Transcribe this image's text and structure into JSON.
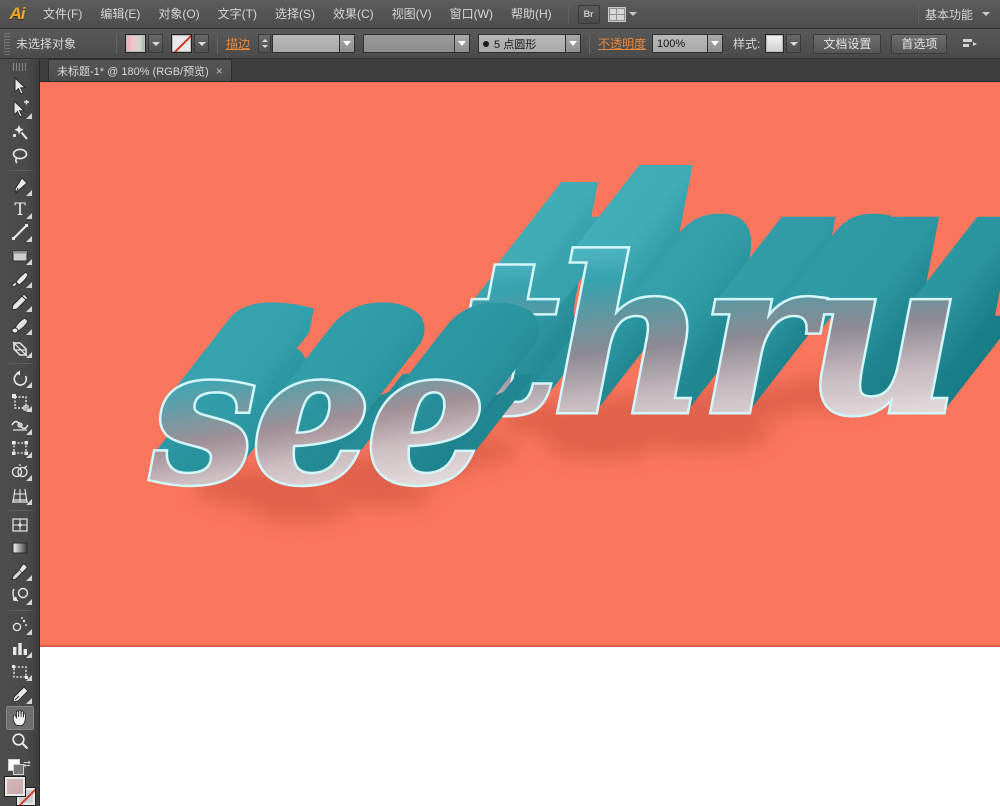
{
  "app": {
    "name": "Adobe Illustrator",
    "logo_text": "Ai"
  },
  "menubar": {
    "items": [
      {
        "label": "文件(F)",
        "name": "menu-file"
      },
      {
        "label": "编辑(E)",
        "name": "menu-edit"
      },
      {
        "label": "对象(O)",
        "name": "menu-object"
      },
      {
        "label": "文字(T)",
        "name": "menu-type"
      },
      {
        "label": "选择(S)",
        "name": "menu-select"
      },
      {
        "label": "效果(C)",
        "name": "menu-effect"
      },
      {
        "label": "视图(V)",
        "name": "menu-view"
      },
      {
        "label": "窗口(W)",
        "name": "menu-window"
      },
      {
        "label": "帮助(H)",
        "name": "menu-help"
      }
    ],
    "bridge_icon_label": "Br",
    "workspace_label": "基本功能"
  },
  "controlbar": {
    "selection_status": "未选择对象",
    "fill_label": "填色",
    "stroke_swatch_label": "描边颜色",
    "stroke_label": "描边",
    "stroke_weight_value": "",
    "stroke_profile_value": "",
    "brush_value": "5 点圆形",
    "opacity_label": "不透明度",
    "opacity_value": "100%",
    "style_label": "样式:",
    "document_setup_label": "文档设置",
    "preferences_label": "首选项"
  },
  "tabbar": {
    "document_tab": "未标题-1* @ 180% (RGB/预览)",
    "close_glyph": "×"
  },
  "toolbar": {
    "tools": [
      {
        "name": "selection-tool",
        "title": "选择工具"
      },
      {
        "name": "direct-selection-tool",
        "title": "直接选择工具"
      },
      {
        "name": "magic-wand-tool",
        "title": "魔棒工具"
      },
      {
        "name": "lasso-tool",
        "title": "套索工具"
      },
      {
        "name": "pen-tool",
        "title": "钢笔工具"
      },
      {
        "name": "type-tool",
        "title": "文字工具"
      },
      {
        "name": "line-segment-tool",
        "title": "直线段工具"
      },
      {
        "name": "rectangle-tool",
        "title": "矩形工具"
      },
      {
        "name": "paintbrush-tool",
        "title": "画笔工具"
      },
      {
        "name": "pencil-tool",
        "title": "铅笔工具"
      },
      {
        "name": "blob-brush-tool",
        "title": "斑点画笔工具"
      },
      {
        "name": "eraser-tool",
        "title": "橡皮擦工具"
      },
      {
        "name": "rotate-tool",
        "title": "旋转工具"
      },
      {
        "name": "scale-tool",
        "title": "比例缩放工具"
      },
      {
        "name": "width-tool",
        "title": "宽度工具"
      },
      {
        "name": "free-transform-tool",
        "title": "自由变换工具"
      },
      {
        "name": "shape-builder-tool",
        "title": "形状生成器工具"
      },
      {
        "name": "perspective-grid-tool",
        "title": "透视网格工具"
      },
      {
        "name": "mesh-tool",
        "title": "网格工具"
      },
      {
        "name": "gradient-tool",
        "title": "渐变工具"
      },
      {
        "name": "eyedropper-tool",
        "title": "吸管工具"
      },
      {
        "name": "blend-tool",
        "title": "混合工具"
      },
      {
        "name": "symbol-sprayer-tool",
        "title": "符号喷枪工具"
      },
      {
        "name": "column-graph-tool",
        "title": "柱形图工具"
      },
      {
        "name": "artboard-tool",
        "title": "画板工具"
      },
      {
        "name": "slice-tool",
        "title": "切片工具"
      },
      {
        "name": "hand-tool",
        "title": "抓手工具",
        "selected": true
      },
      {
        "name": "zoom-tool",
        "title": "缩放工具"
      }
    ],
    "fill_stroke": {
      "fill_color": "#d9b7bb",
      "stroke_color": "none",
      "swap_glyph": "⇄"
    }
  },
  "artwork": {
    "text_line_1": "see",
    "text_line_2": "thru",
    "background_color": "#fa765d",
    "face_color_light": "#7fd3dd",
    "face_color_dark": "#1f8c93",
    "extrude_color": "#2f9aa3",
    "outline_color": "#ccf6fb",
    "shadow_color": "#e0604c",
    "canvas_color": "#ffffff"
  }
}
